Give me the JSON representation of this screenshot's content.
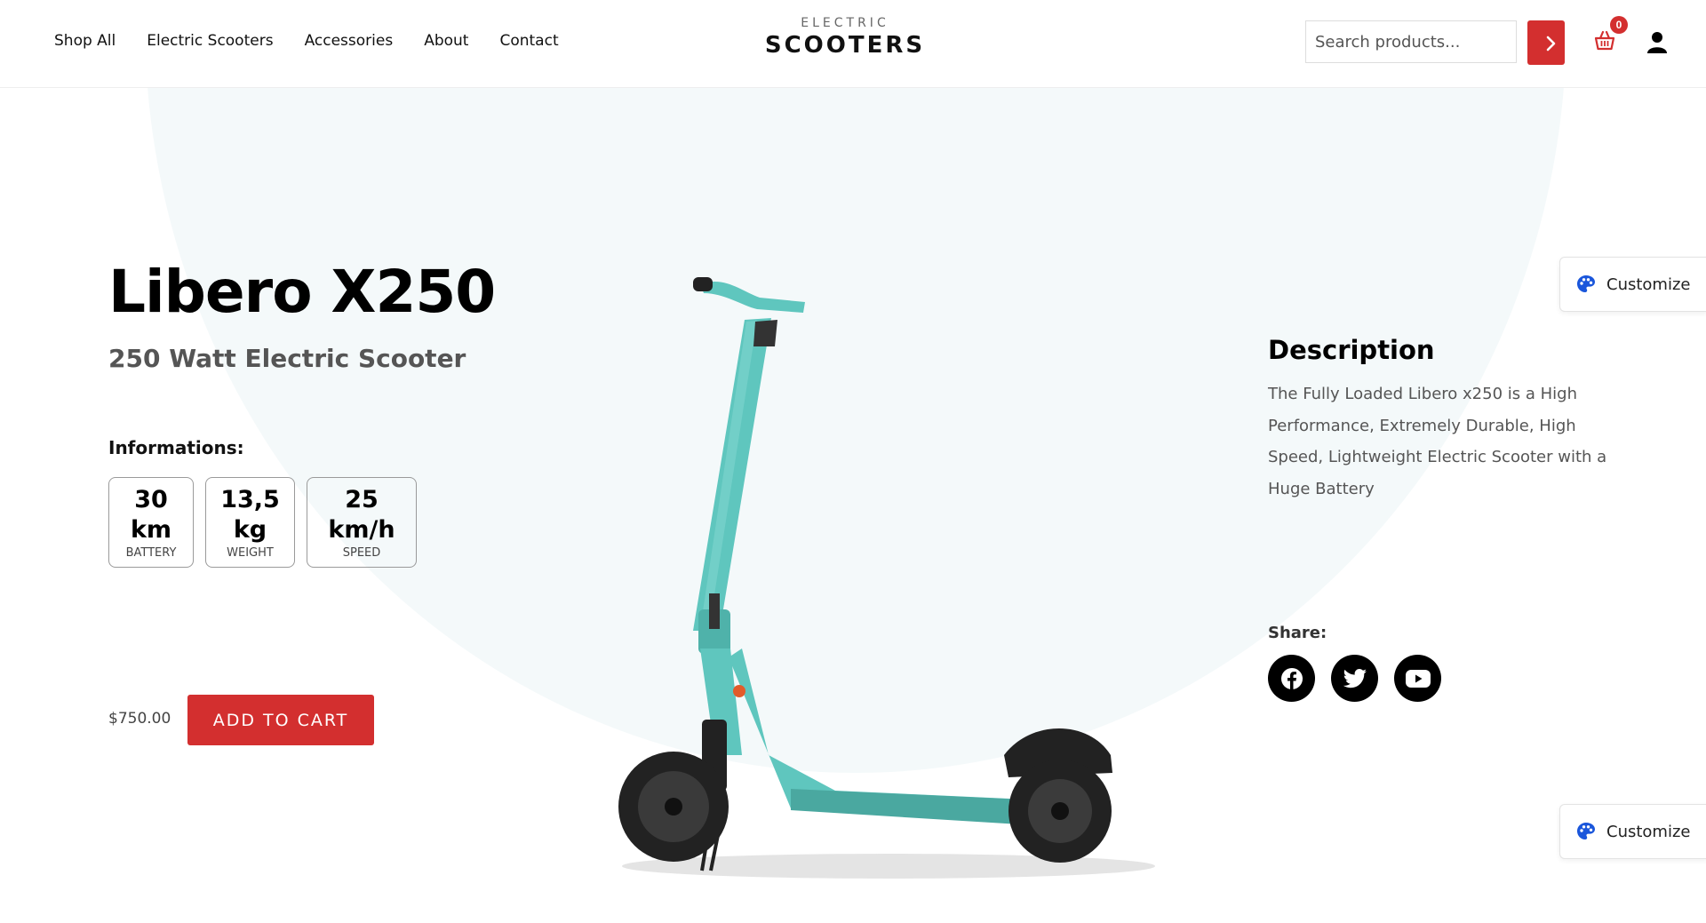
{
  "nav": {
    "items": [
      "Shop All",
      "Electric Scooters",
      "Accessories",
      "About",
      "Contact"
    ]
  },
  "logo": {
    "top": "ELECTRIC",
    "main": "SCOOTERS"
  },
  "search": {
    "placeholder": "Search products..."
  },
  "cart": {
    "count": "0"
  },
  "product": {
    "title": "Libero X250",
    "subtitle": "250 Watt Electric Scooter",
    "info_label": "Informations:",
    "specs": [
      {
        "value_line1": "30",
        "value_line2": "km",
        "unit": "BATTERY"
      },
      {
        "value_line1": "13,5",
        "value_line2": "kg",
        "unit": "WEIGHT"
      },
      {
        "value_line1": "25",
        "value_line2": "km/h",
        "unit": "SPEED"
      }
    ],
    "price": "$750.00",
    "add_to_cart": "ADD TO CART"
  },
  "description": {
    "title": "Description",
    "text": "The Fully Loaded Libero x250 is a High Performance, Extremely Durable, High Speed, Lightweight Electric Scooter with a Huge Battery"
  },
  "share": {
    "label": "Share:",
    "icons": [
      "facebook-icon",
      "twitter-icon",
      "youtube-icon"
    ]
  },
  "customize": {
    "label": "Customize"
  },
  "colors": {
    "accent": "#d32f2f",
    "scooter": "#5fc6be",
    "circle_bg": "#f4f9fa"
  }
}
